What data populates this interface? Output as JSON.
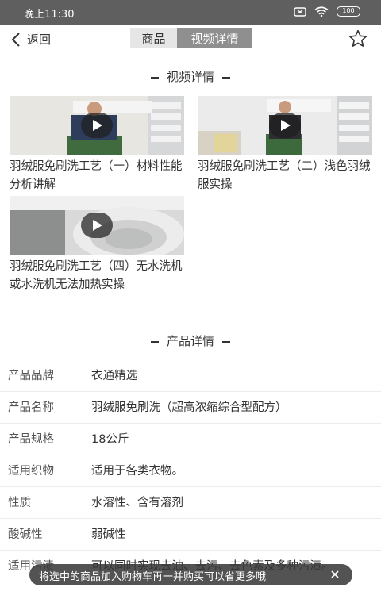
{
  "status_bar": {
    "time": "晚上11:30",
    "battery": "100"
  },
  "nav": {
    "back_label": "返回",
    "tabs": [
      {
        "label": "商品",
        "active": false
      },
      {
        "label": "视频详情",
        "active": true
      }
    ]
  },
  "video_section": {
    "title": "视频详情",
    "videos": [
      {
        "title": "羽绒服免刷洗工艺（一）材料性能分析讲解"
      },
      {
        "title": "羽绒服免刷洗工艺（二）浅色羽绒服实操"
      },
      {
        "title": "羽绒服免刷洗工艺（四）无水洗机或水洗机无法加热实操"
      }
    ]
  },
  "product_section": {
    "title": "产品详情",
    "specs": [
      {
        "key": "产品品牌",
        "value": "衣通精选"
      },
      {
        "key": "产品名称",
        "value": "羽绒服免刷洗（超高浓缩综合型配方）"
      },
      {
        "key": "产品规格",
        "value": "18公斤"
      },
      {
        "key": "适用织物",
        "value": "适用于各类衣物。"
      },
      {
        "key": "性质",
        "value": "水溶性、含有溶剂"
      },
      {
        "key": "酸碱性",
        "value": "弱碱性"
      },
      {
        "key": "适用污渍",
        "value": "可以同时实现去油、去污、去色素及多种污渍。"
      }
    ]
  },
  "toast": {
    "text": "将选中的商品加入购物车再一并购买可以省更多哦"
  },
  "colors": {
    "status_bar": "#5f5f5f",
    "active_tab": "#8f8f8f",
    "inactive_tab": "#e6e6e6"
  }
}
